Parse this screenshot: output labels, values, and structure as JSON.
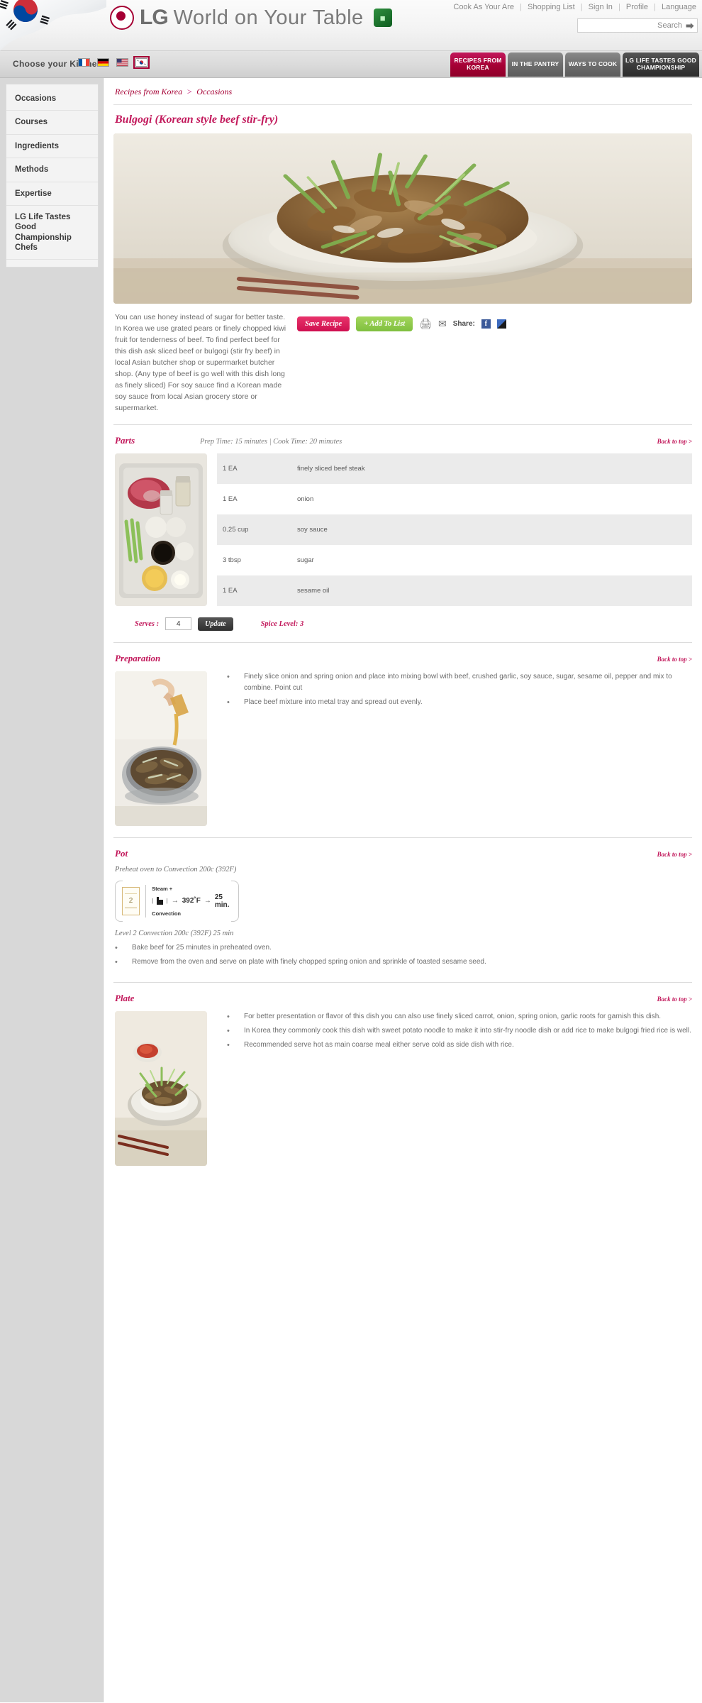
{
  "header": {
    "brand_lg": "LG",
    "brand_tagline": "World on Your Table",
    "lightwave_label": "Lightwave",
    "topnav": [
      {
        "label": "Cook As Your Are"
      },
      {
        "label": "Shopping List"
      },
      {
        "label": "Sign In"
      },
      {
        "label": "Profile"
      },
      {
        "label": "Language"
      }
    ],
    "search": {
      "value": "",
      "placeholder": "",
      "label": "Search"
    }
  },
  "kitchenbar": {
    "choose_label": "Choose your Kitchen",
    "flags": [
      {
        "name": "france",
        "selected": false
      },
      {
        "name": "germany",
        "selected": false
      },
      {
        "name": "usa",
        "selected": false
      },
      {
        "name": "korea",
        "selected": true
      }
    ],
    "tabs": [
      {
        "label": "RECIPES FROM KOREA",
        "active": true
      },
      {
        "label": "IN THE PANTRY",
        "active": false
      },
      {
        "label": "WAYS TO COOK",
        "active": false
      },
      {
        "label": "LG LIFE TASTES GOOD CHAMPIONSHIP",
        "active": false
      }
    ]
  },
  "sidebar": {
    "items": [
      {
        "label": "Occasions"
      },
      {
        "label": "Courses"
      },
      {
        "label": "Ingredients"
      },
      {
        "label": "Methods"
      },
      {
        "label": "Expertise"
      },
      {
        "label": "LG Life Tastes Good Championship Chefs"
      }
    ]
  },
  "main": {
    "breadcrumb_root": "Recipes from Korea",
    "breadcrumb_sep": ">",
    "breadcrumb_current": "Occasions",
    "title": "Bulgogi (Korean style beef stir-fry)",
    "description": "You can use honey instead of sugar for better taste. In Korea we use grated pears or finely chopped kiwi fruit for tenderness of beef. To find perfect beef for this dish ask sliced beef or bulgogi (stir fry beef) in local Asian butcher shop or supermarket butcher shop. (Any type of beef is go well with this dish long as finely sliced) For soy sauce find a Korean made soy sauce from local Asian grocery store or supermarket.",
    "actions": {
      "save_label": "Save Recipe",
      "add_label": "+ Add To List",
      "share_label": "Share:"
    }
  },
  "parts": {
    "title": "Parts",
    "prep_time": "Prep Time: 15 minutes",
    "meta_sep": "|",
    "cook_time": "Cook Time: 20 minutes",
    "back_to_top": "Back to top >",
    "ingredients": [
      {
        "qty": "1 EA",
        "item": "finely sliced beef steak"
      },
      {
        "qty": "1 EA",
        "item": "onion"
      },
      {
        "qty": "0.25 cup",
        "item": "soy sauce"
      },
      {
        "qty": "3 tbsp",
        "item": "sugar"
      },
      {
        "qty": "1 EA",
        "item": "sesame oil"
      }
    ],
    "serves_label": "Serves :",
    "serves_value": "4",
    "update_label": "Update",
    "spice_level": "Spice Level: 3"
  },
  "preparation": {
    "title": "Preparation",
    "back_to_top": "Back to top >",
    "steps": [
      "Finely slice onion and spring onion and place into mixing bowl with beef, crushed garlic, soy sauce, sugar, sesame oil, pepper and mix to combine. Point cut",
      "Place beef mixture into metal tray and spread out evenly."
    ]
  },
  "pot": {
    "title": "Pot",
    "back_to_top": "Back to top >",
    "preheat_note": "Preheat oven to Convection 200c (392F)",
    "oven": {
      "level": "2",
      "mode_top": "Steam +",
      "mode_bottom": "Convection",
      "temperature": "392˚F",
      "duration": "25 min.",
      "arrow": "→"
    },
    "level_note": "Level 2 Convection 200c (392F) 25 min",
    "steps": [
      "Bake beef for 25 minutes in preheated oven.",
      "Remove from the oven and serve on plate with finely chopped spring onion and sprinkle of toasted sesame seed."
    ]
  },
  "plate": {
    "title": "Plate",
    "back_to_top": "Back to top >",
    "steps": [
      "For better presentation or flavor of this dish you can also use finely sliced carrot, onion, spring onion, garlic roots for garnish this dish.",
      "In Korea they commonly cook this dish with sweet potato noodle to make it into stir-fry noodle dish or add rice to make bulgogi fried rice is well.",
      "Recommended serve hot as main coarse meal either serve cold as side dish with rice."
    ]
  },
  "colors": {
    "accent": "#a50034",
    "title_pink": "#c2185b",
    "green_button": "#7fbf3f"
  }
}
